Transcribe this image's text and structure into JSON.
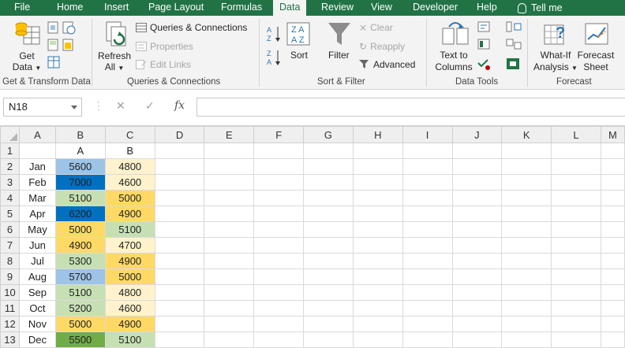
{
  "tabs": [
    {
      "label": "File",
      "active": false
    },
    {
      "label": "Home",
      "active": false
    },
    {
      "label": "Insert",
      "active": false
    },
    {
      "label": "Page Layout",
      "active": false
    },
    {
      "label": "Formulas",
      "active": false
    },
    {
      "label": "Data",
      "active": true
    },
    {
      "label": "Review",
      "active": false
    },
    {
      "label": "View",
      "active": false
    },
    {
      "label": "Developer",
      "active": false
    },
    {
      "label": "Help",
      "active": false
    }
  ],
  "tell_me": "Tell me",
  "ribbon": {
    "get_data_l1": "Get",
    "get_data_l2": "Data",
    "get_transform_label": "Get & Transform Data",
    "refresh_l1": "Refresh",
    "refresh_l2": "All",
    "queries_connections": "Queries & Connections",
    "properties": "Properties",
    "edit_links": "Edit Links",
    "queries_group_label": "Queries & Connections",
    "sort": "Sort",
    "filter": "Filter",
    "clear": "Clear",
    "reapply": "Reapply",
    "advanced": "Advanced",
    "sort_filter_label": "Sort & Filter",
    "text_to_columns_l1": "Text to",
    "text_to_columns_l2": "Columns",
    "data_tools_label": "Data Tools",
    "what_if_l1": "What-If",
    "what_if_l2": "Analysis",
    "forecast_sheet_l1": "Forecast",
    "forecast_sheet_l2": "Sheet",
    "forecast_label": "Forecast"
  },
  "formula_bar": {
    "name_box": "N18",
    "cancel": "✕",
    "enter": "✓",
    "fx": "fx",
    "value": ""
  },
  "sheet": {
    "columns": [
      "A",
      "B",
      "C",
      "D",
      "E",
      "F",
      "G",
      "H",
      "I",
      "J",
      "K",
      "L",
      "M"
    ],
    "rows": [
      {
        "num": "1",
        "month": "",
        "a": "A",
        "b": "B",
        "a_color": "",
        "b_color": "",
        "a_text": "#222222"
      },
      {
        "num": "2",
        "month": "Jan",
        "a": "5600",
        "b": "4800",
        "a_color": "#9dc3e6",
        "b_color": "#fff2cc",
        "a_text": "#222222"
      },
      {
        "num": "3",
        "month": "Feb",
        "a": "7000",
        "b": "4600",
        "a_color": "#0070c0",
        "b_color": "#fff2cc",
        "a_text": "#222222"
      },
      {
        "num": "4",
        "month": "Mar",
        "a": "5100",
        "b": "5000",
        "a_color": "#c6e0b4",
        "b_color": "#ffd966",
        "a_text": "#222222"
      },
      {
        "num": "5",
        "month": "Apr",
        "a": "6200",
        "b": "4900",
        "a_color": "#0070c0",
        "b_color": "#ffd966",
        "a_text": "#222222"
      },
      {
        "num": "6",
        "month": "May",
        "a": "5000",
        "b": "5100",
        "a_color": "#ffd966",
        "b_color": "#c6e0b4",
        "a_text": "#222222"
      },
      {
        "num": "7",
        "month": "Jun",
        "a": "4900",
        "b": "4700",
        "a_color": "#ffd966",
        "b_color": "#fff2cc",
        "a_text": "#222222"
      },
      {
        "num": "8",
        "month": "Jul",
        "a": "5300",
        "b": "4900",
        "a_color": "#c6e0b4",
        "b_color": "#ffd966",
        "a_text": "#222222"
      },
      {
        "num": "9",
        "month": "Aug",
        "a": "5700",
        "b": "5000",
        "a_color": "#9dc3e6",
        "b_color": "#ffd966",
        "a_text": "#222222"
      },
      {
        "num": "10",
        "month": "Sep",
        "a": "5100",
        "b": "4800",
        "a_color": "#c6e0b4",
        "b_color": "#fff2cc",
        "a_text": "#222222"
      },
      {
        "num": "11",
        "month": "Oct",
        "a": "5200",
        "b": "4600",
        "a_color": "#c6e0b4",
        "b_color": "#fff2cc",
        "a_text": "#222222"
      },
      {
        "num": "12",
        "month": "Nov",
        "a": "5000",
        "b": "4900",
        "a_color": "#ffd966",
        "b_color": "#ffd966",
        "a_text": "#222222"
      },
      {
        "num": "13",
        "month": "Dec",
        "a": "5500",
        "b": "5100",
        "a_color": "#70ad47",
        "b_color": "#c6e0b4",
        "a_text": "#222222"
      }
    ]
  }
}
